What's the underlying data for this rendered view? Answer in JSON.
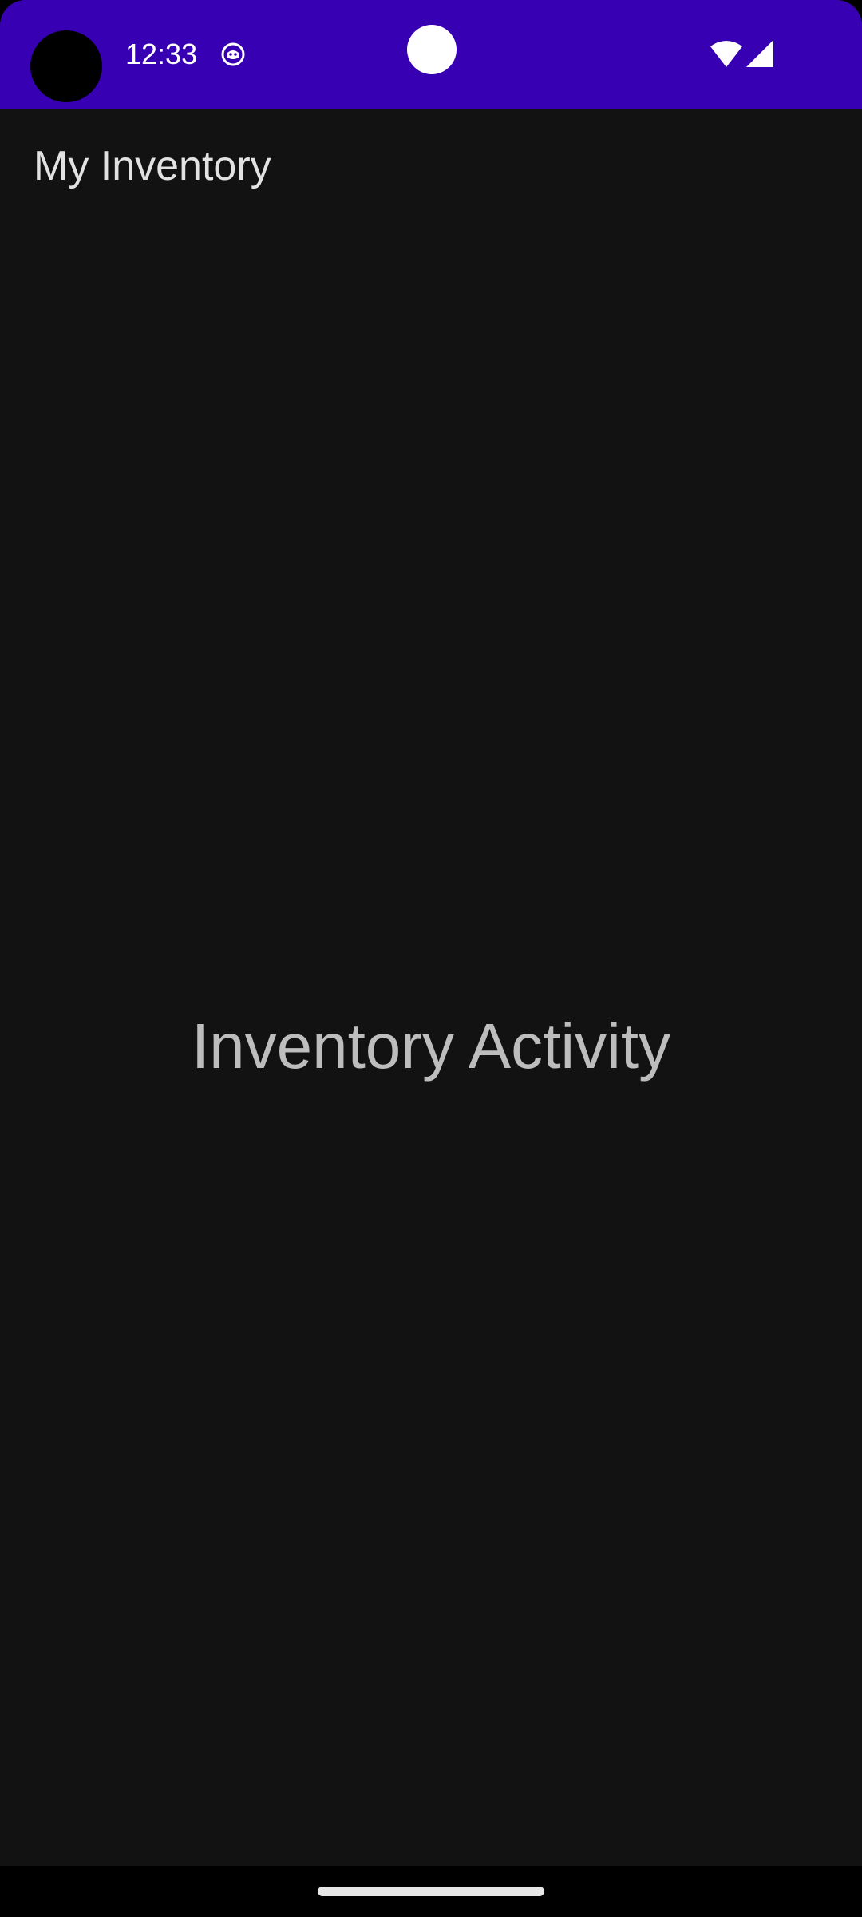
{
  "status_bar": {
    "time": "12:33",
    "background_color": "#3700b3",
    "icons": [
      "notification-icon",
      "wifi-icon",
      "cellular-signal-icon"
    ]
  },
  "app_bar": {
    "title": "My Inventory"
  },
  "main": {
    "center_text": "Inventory Activity"
  },
  "theme": {
    "background": "#121212",
    "title_color": "#e2e2e2",
    "body_text_color": "#bdbdbd"
  }
}
